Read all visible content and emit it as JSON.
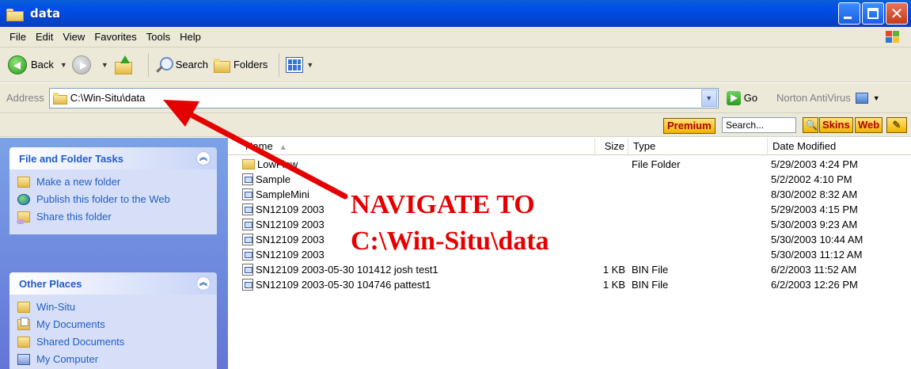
{
  "window": {
    "title": "data"
  },
  "menu": [
    "File",
    "Edit",
    "View",
    "Favorites",
    "Tools",
    "Help"
  ],
  "toolbar": {
    "back": "Back",
    "search": "Search",
    "folders": "Folders"
  },
  "address": {
    "label": "Address",
    "path": "C:\\Win-Situ\\data",
    "go": "Go",
    "norton": "Norton AntiVirus"
  },
  "searchbar": {
    "premium": "Premium",
    "placeholder": "Search...",
    "skins": "Skins",
    "web": "Web"
  },
  "tasks": {
    "file_folder": {
      "title": "File and Folder Tasks",
      "items": [
        "Make a new folder",
        "Publish this folder to the Web",
        "Share this folder"
      ]
    },
    "other_places": {
      "title": "Other Places",
      "items": [
        "Win-Situ",
        "My Documents",
        "Shared Documents",
        "My Computer"
      ]
    }
  },
  "columns": {
    "name": "Name",
    "size": "Size",
    "type": "Type",
    "date": "Date Modified"
  },
  "files": [
    {
      "name": "LowFlow",
      "size": "",
      "type": "File Folder",
      "date": "5/29/2003 4:24 PM",
      "kind": "folder"
    },
    {
      "name": "Sample",
      "size": "",
      "type": "",
      "date": "5/2/2002 4:10 PM",
      "kind": "file"
    },
    {
      "name": "SampleMini",
      "size": "",
      "type": "",
      "date": "8/30/2002 8:32 AM",
      "kind": "file"
    },
    {
      "name": "SN12109 2003",
      "size": "",
      "type": "",
      "date": "5/29/2003 4:15 PM",
      "kind": "file"
    },
    {
      "name": "SN12109 2003",
      "size": "",
      "type": "",
      "date": "5/30/2003 9:23 AM",
      "kind": "file"
    },
    {
      "name": "SN12109 2003",
      "size": "",
      "type": "",
      "date": "5/30/2003 10:44 AM",
      "kind": "file"
    },
    {
      "name": "SN12109 2003",
      "size": "",
      "type": "",
      "date": "5/30/2003 11:12 AM",
      "kind": "file"
    },
    {
      "name": "SN12109 2003-05-30 101412 josh test1",
      "size": "1 KB",
      "type": "BIN File",
      "date": "6/2/2003 11:52 AM",
      "kind": "file"
    },
    {
      "name": "SN12109 2003-05-30 104746 pattest1",
      "size": "1 KB",
      "type": "BIN File",
      "date": "6/2/2003 12:26 PM",
      "kind": "file"
    }
  ],
  "annotation": {
    "line1": "NAVIGATE TO",
    "line2": "C:\\Win-Situ\\data",
    "color": "#e50000"
  }
}
